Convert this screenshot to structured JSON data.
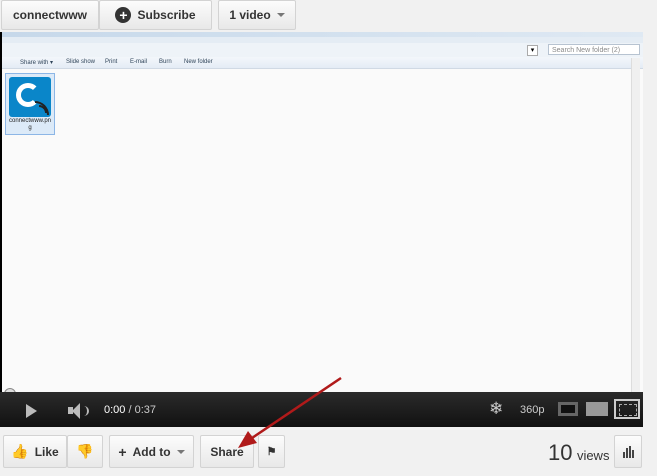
{
  "channel": {
    "name": "connectwww",
    "subscribe_label": "Subscribe",
    "videos_label": "1 video"
  },
  "video_frame": {
    "address_placeholder": "Search New folder (2)",
    "toolbar": [
      "Share with ▾",
      "Slide show",
      "Print",
      "E-mail",
      "Burn",
      "New folder"
    ],
    "file": {
      "name_line1": "connectwww.pn",
      "name_line2": "g"
    }
  },
  "player": {
    "current_time": "0:00",
    "separator": "/",
    "duration": "0:37",
    "quality": "360p",
    "progress": 0.0
  },
  "actions": {
    "like_label": "Like",
    "add_to_label": "Add to",
    "share_label": "Share"
  },
  "stats": {
    "views_count": "10",
    "views_label": "views"
  },
  "colors": {
    "arrow": "#b01a1a",
    "accent": "#0a86c9"
  }
}
